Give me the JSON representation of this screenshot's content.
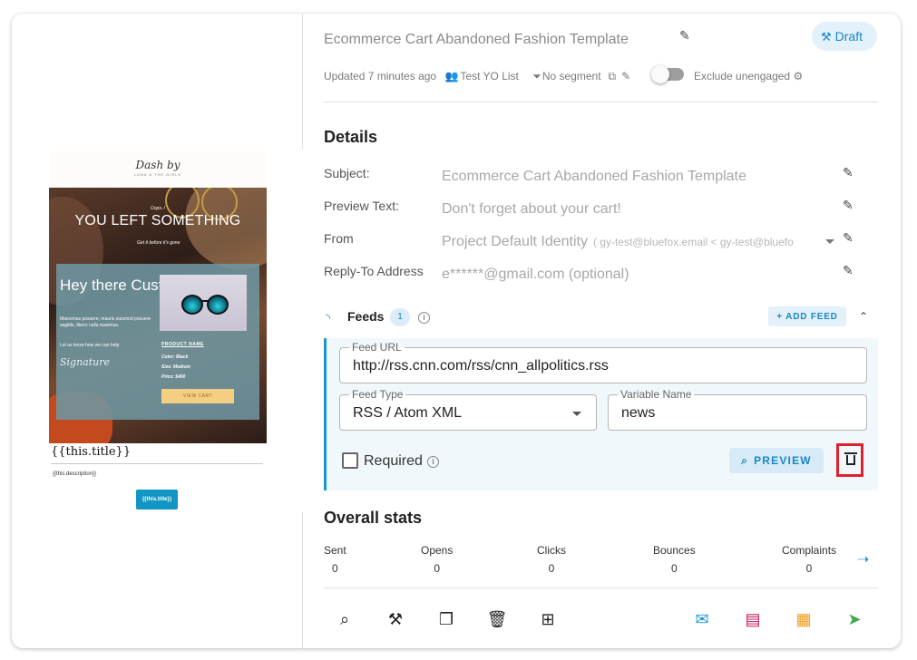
{
  "preview": {
    "logo_line1": "Dash by",
    "logo_line2": "LUNA & THE GIRLS",
    "oops": "Oops..!",
    "headline": "YOU LEFT SOMETHING",
    "get_it": "Get it before it's gone",
    "greeting": "Hey there Customer!",
    "body": "Maecenas posuere, mauris euismod posuere sagittis, libero nulla maximus.",
    "let_us": "Let us know how we can help.",
    "signature": "Signature",
    "product_name": "PRODUCT NAME",
    "color": "Color: Black",
    "size": "Size: Medium",
    "price": "Price: $400",
    "view_cart": "VIEW CART",
    "feed_title": "{{this.title}}",
    "feed_desc": "{{this.description}}",
    "feed_cta": "{{this.title}}"
  },
  "header": {
    "template_name": "Ecommerce Cart Abandoned Fashion Template",
    "status": "Draft",
    "updated": "Updated 7 minutes ago",
    "list": "Test YO List",
    "segment": "No segment",
    "exclude_unengaged": "Exclude unengaged"
  },
  "details": {
    "heading": "Details",
    "fields": [
      {
        "label": "Subject:",
        "value": "Ecommerce Cart Abandoned Fashion Template"
      },
      {
        "label": "Preview Text:",
        "value": "Don't forget about your cart!"
      },
      {
        "label": "From",
        "value": "Project Default Identity",
        "sub": "( gy-test@bluefox.email < gy-test@bluefo"
      },
      {
        "label": "Reply-To Address",
        "value": "e******@gmail.com (optional)"
      }
    ]
  },
  "feeds": {
    "label": "Feeds",
    "count": "1",
    "add_label": "ADD FEED",
    "feed_url_label": "Feed URL",
    "feed_url": "http://rss.cnn.com/rss/cnn_allpolitics.rss",
    "feed_type_label": "Feed Type",
    "feed_type": "RSS / Atom XML",
    "variable_label": "Variable Name",
    "variable": "news",
    "required_label": "Required",
    "preview_label": "PREVIEW"
  },
  "stats": {
    "heading": "Overall stats",
    "items": [
      {
        "label": "Sent",
        "value": "0"
      },
      {
        "label": "Opens",
        "value": "0"
      },
      {
        "label": "Clicks",
        "value": "0"
      },
      {
        "label": "Bounces",
        "value": "0"
      },
      {
        "label": "Complaints",
        "value": "0"
      }
    ]
  },
  "colors": {
    "accent": "#1a86c8",
    "delete_highlight": "#e0202a",
    "send_green": "#3ea84a",
    "schedule_orange": "#f09a1e",
    "review_red": "#c2185b"
  }
}
